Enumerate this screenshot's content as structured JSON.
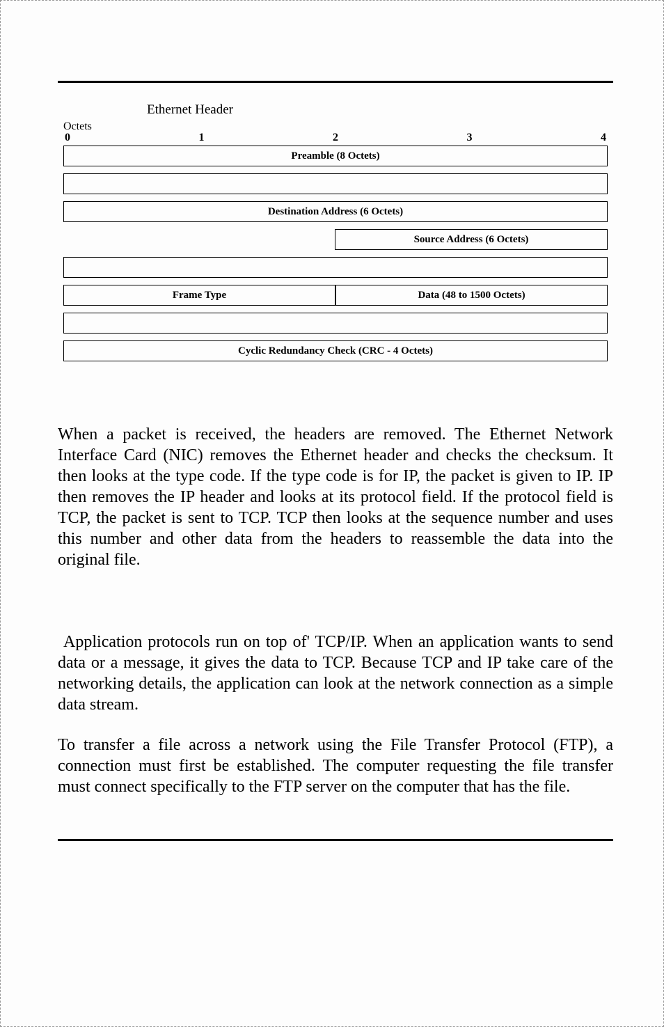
{
  "diagram": {
    "title": "Ethernet Header",
    "octets_label": "Octets",
    "scale": [
      "0",
      "1",
      "2",
      "3",
      "4"
    ],
    "preamble": "Preamble (8 Octets)",
    "dest_addr": "Destination Address (6 Octets)",
    "src_addr": "Source Address (6 Octets)",
    "frame_type": "Frame Type",
    "data": "Data (48 to 1500 Octets)",
    "crc": "Cyclic Redundancy Check (CRC - 4 Octets)"
  },
  "paragraphs": {
    "p1": "When a packet is received, the headers are removed. The Ethernet Network Interface Card (NIC) removes the Ethernet header and checks the checksum. It then looks at the type code. If the type code is for IP, the packet is given to IP. IP then removes the IP header and looks at its protocol field. If the protocol field is TCP, the packet is sent to TCP. TCP then looks at the sequence number and uses this number and other data from the headers to reassemble the data into the original file.",
    "p2": " Application protocols run on top of' TCP/IP. When an application wants to send data or a message, it gives the data to TCP. Because TCP and IP take care of the networking details, the application can look at the network connection as a simple data stream.",
    "p3": "To transfer a file across a network using the File Transfer Protocol (FTP), a connection must first be established. The computer requesting the file transfer must connect specifically to the FTP server on the computer that has the file."
  }
}
